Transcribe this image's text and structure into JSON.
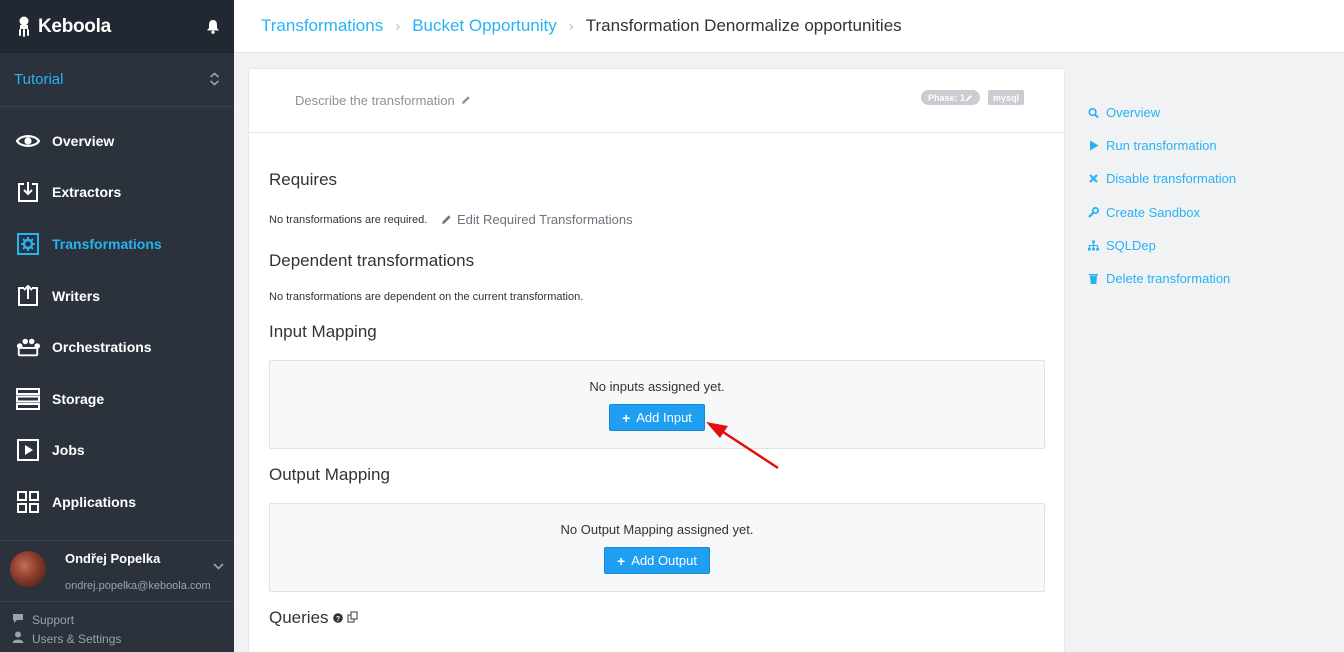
{
  "brand": {
    "name": "Keboola"
  },
  "project": {
    "name": "Tutorial"
  },
  "nav": [
    {
      "label": "Overview",
      "icon": "eye-icon"
    },
    {
      "label": "Extractors",
      "icon": "download-icon"
    },
    {
      "label": "Transformations",
      "icon": "gear-icon",
      "active": true
    },
    {
      "label": "Writers",
      "icon": "upload-icon"
    },
    {
      "label": "Orchestrations",
      "icon": "orchestration-icon"
    },
    {
      "label": "Storage",
      "icon": "storage-icon"
    },
    {
      "label": "Jobs",
      "icon": "play-icon"
    },
    {
      "label": "Applications",
      "icon": "grid-icon"
    }
  ],
  "user": {
    "name": "Ondřej Popelka",
    "email": "ondrej.popelka@keboola.com"
  },
  "bottom_links": {
    "support": "Support",
    "settings": "Users & Settings"
  },
  "breadcrumb": {
    "items": [
      "Transformations",
      "Bucket Opportunity"
    ],
    "current": "Transformation Denormalize opportunities"
  },
  "card": {
    "describe": "Describe the transformation",
    "phase_badge": "Phase: 1",
    "backend_badge": "mysql",
    "requires": {
      "title": "Requires",
      "empty": "No transformations are required.",
      "edit_link": "Edit Required Transformations"
    },
    "dependent": {
      "title": "Dependent transformations",
      "empty": "No transformations are dependent on the current transformation."
    },
    "input": {
      "title": "Input Mapping",
      "empty": "No inputs assigned yet.",
      "button": "Add Input"
    },
    "output": {
      "title": "Output Mapping",
      "empty": "No Output Mapping assigned yet.",
      "button": "Add Output"
    },
    "queries": {
      "title": "Queries"
    }
  },
  "actions": [
    {
      "label": "Overview",
      "icon": "search-icon"
    },
    {
      "label": "Run transformation",
      "icon": "play-icon"
    },
    {
      "label": "Disable transformation",
      "icon": "close-icon"
    },
    {
      "label": "Create Sandbox",
      "icon": "wrench-icon"
    },
    {
      "label": "SQLDep",
      "icon": "sitemap-icon"
    },
    {
      "label": "Delete transformation",
      "icon": "trash-icon"
    }
  ],
  "colors": {
    "accent": "#27b3f3",
    "sidebar": "#2b323c",
    "button": "#1f9ef2",
    "annotation": "#e01010"
  }
}
